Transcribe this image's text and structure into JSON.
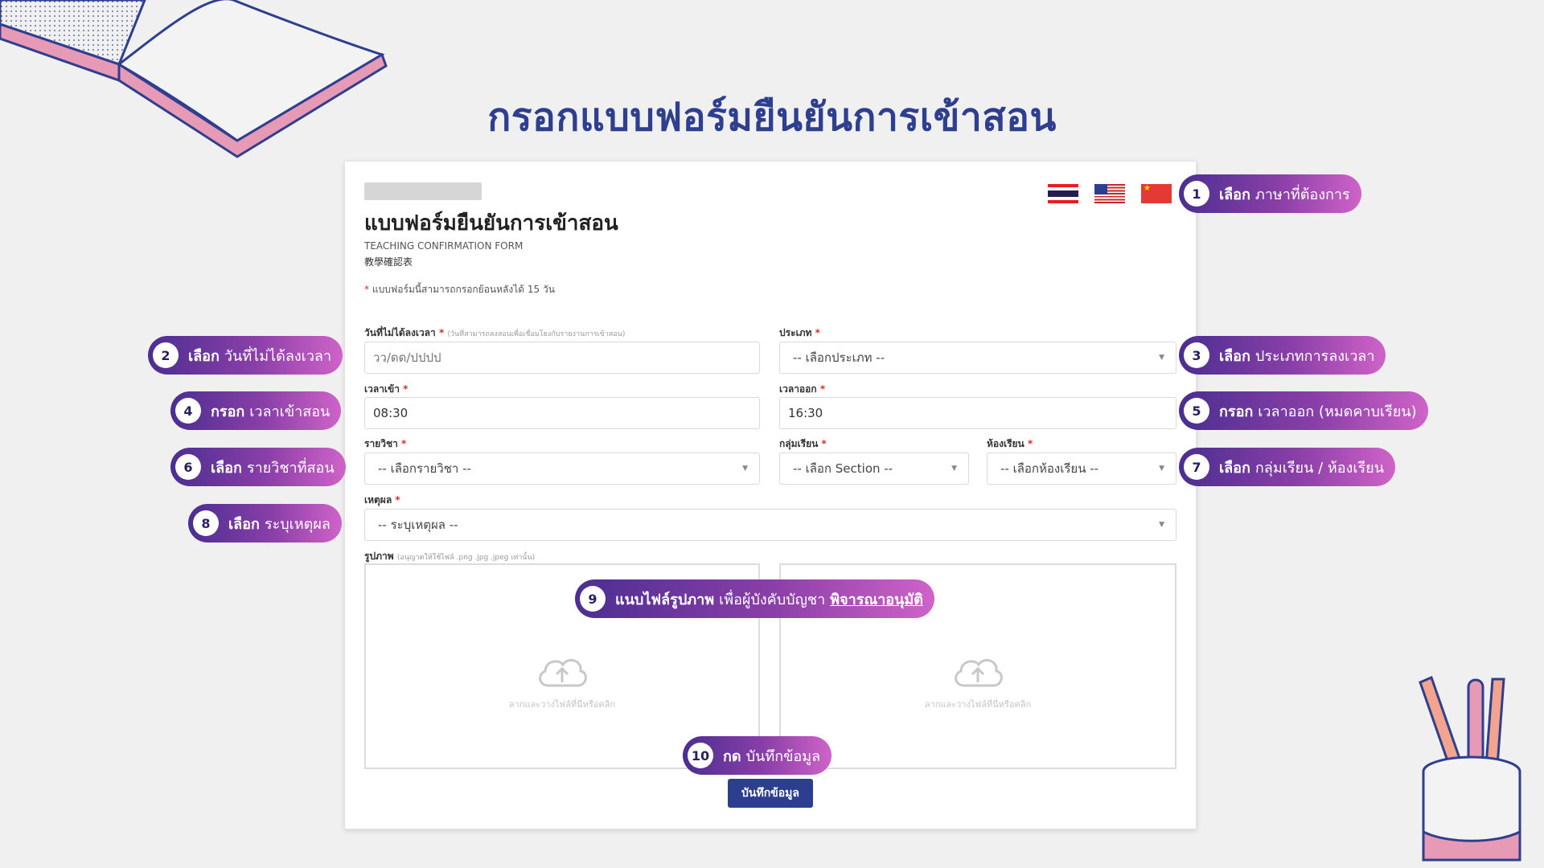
{
  "page": {
    "title": "กรอกแบบฟอร์มยืนยันการเข้าสอน"
  },
  "form": {
    "title": "แบบฟอร์มยืนยันการเข้าสอน",
    "subtitle_en": "TEACHING CONFIRMATION FORM",
    "subtitle_cn": "教學確認表",
    "note": "แบบฟอร์มนี้สามารถกรอกย้อนหลังได้ 15 วัน",
    "required_mark": "*",
    "languages": [
      "th-flag",
      "us-flag",
      "cn-flag"
    ],
    "fields": {
      "date": {
        "label": "วันที่ไม่ได้ลงเวลา",
        "hint": "(วันที่สามารถลงสอนเพื่อเชื่อมโยงกับรายงานการเข้าสอน)",
        "placeholder": "วว/ดด/ปปปป"
      },
      "type": {
        "label": "ประเภท",
        "value": "-- เลือกประเภท --"
      },
      "time_in": {
        "label": "เวลาเข้า",
        "value": "08:30"
      },
      "time_out": {
        "label": "เวลาออก",
        "value": "16:30"
      },
      "subject": {
        "label": "รายวิชา",
        "value": "-- เลือกรายวิชา --"
      },
      "section": {
        "label": "กลุ่มเรียน",
        "value": "-- เลือก Section --"
      },
      "room": {
        "label": "ห้องเรียน",
        "value": "-- เลือกห้องเรียน --"
      },
      "reason": {
        "label": "เหตุผล",
        "value": "-- ระบุเหตุผล --"
      },
      "image": {
        "label": "รูปภาพ",
        "hint": "(อนุญาตให้ใช้ไฟล์ .png .jpg .jpeg เท่านั้น)"
      }
    },
    "upload_text": "ลากและวางไฟล์ที่นี่หรือคลิก",
    "save_label": "บันทึกข้อมูล"
  },
  "callouts": [
    {
      "num": "1",
      "verb": "เลือก",
      "text": "ภาษาที่ต้องการ"
    },
    {
      "num": "2",
      "verb": "เลือก",
      "text": "วันที่ไม่ได้ลงเวลา"
    },
    {
      "num": "3",
      "verb": "เลือก",
      "text": "ประเภทการลงเวลา"
    },
    {
      "num": "4",
      "verb": "กรอก",
      "text": "เวลาเข้าสอน"
    },
    {
      "num": "5",
      "verb": "กรอก",
      "text": "เวลาออก (หมดคาบเรียน)"
    },
    {
      "num": "6",
      "verb": "เลือก",
      "text": "รายวิชาที่สอน"
    },
    {
      "num": "7",
      "verb": "เลือก",
      "text": "กลุ่มเรียน / ห้องเรียน"
    },
    {
      "num": "8",
      "verb": "เลือก",
      "text": "ระบุเหตุผล"
    },
    {
      "num": "9",
      "verb": "แนบไฟล์รูปภาพ",
      "text": "เพื่อผู้บังคับบัญชา",
      "link": "พิจารณาอนุมัติ"
    },
    {
      "num": "10",
      "verb": "กด",
      "text": "บันทึกข้อมูล"
    }
  ],
  "colors": {
    "brand": "#2c3e8f",
    "pill_start": "#4b2e91",
    "pill_end": "#cf63c8",
    "required": "#d32f2f"
  }
}
